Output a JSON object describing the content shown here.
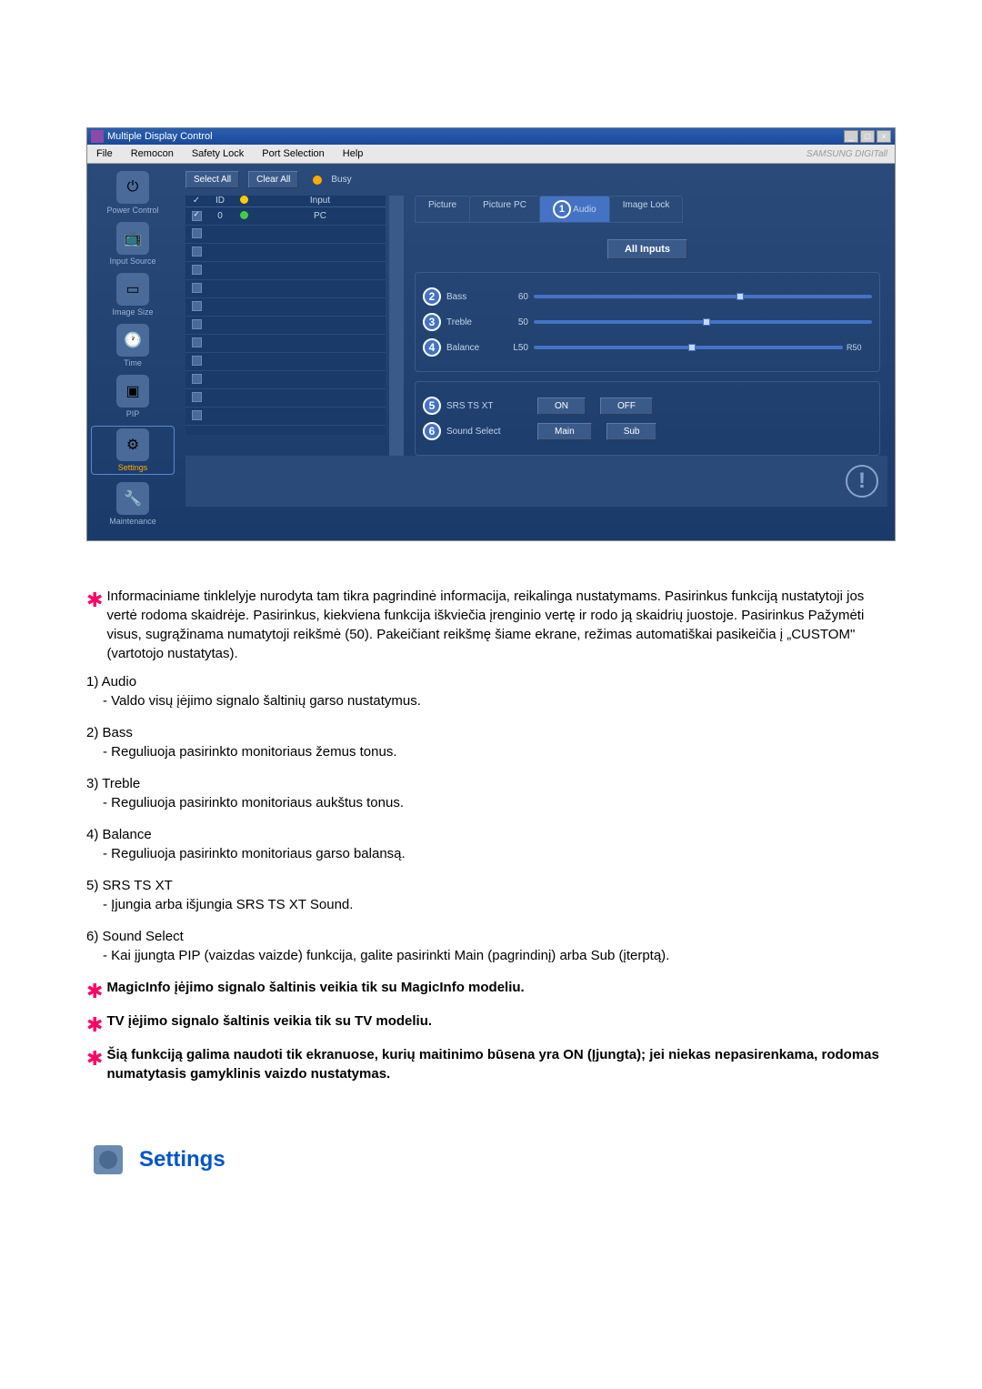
{
  "window": {
    "title": "Multiple Display Control"
  },
  "menu": {
    "file": "File",
    "remocon": "Remocon",
    "safety_lock": "Safety Lock",
    "port_selection": "Port Selection",
    "help": "Help",
    "brand": "SAMSUNG DIGITall"
  },
  "sidebar": {
    "items": [
      {
        "label": "Power Control"
      },
      {
        "label": "Input Source"
      },
      {
        "label": "Image Size"
      },
      {
        "label": "Time"
      },
      {
        "label": "PIP"
      },
      {
        "label": "Settings"
      },
      {
        "label": "Maintenance"
      }
    ]
  },
  "controls": {
    "select_all": "Select All",
    "clear_all": "Clear All",
    "busy": "Busy"
  },
  "list": {
    "headers": {
      "chk": "✓",
      "id": "ID",
      "status": "",
      "input": "Input"
    },
    "rows": [
      {
        "checked": true,
        "id": "0",
        "status": "green",
        "input": "PC"
      },
      {
        "checked": false,
        "id": "",
        "status": "",
        "input": ""
      },
      {
        "checked": false,
        "id": "",
        "status": "",
        "input": ""
      },
      {
        "checked": false,
        "id": "",
        "status": "",
        "input": ""
      },
      {
        "checked": false,
        "id": "",
        "status": "",
        "input": ""
      },
      {
        "checked": false,
        "id": "",
        "status": "",
        "input": ""
      },
      {
        "checked": false,
        "id": "",
        "status": "",
        "input": ""
      },
      {
        "checked": false,
        "id": "",
        "status": "",
        "input": ""
      },
      {
        "checked": false,
        "id": "",
        "status": "",
        "input": ""
      },
      {
        "checked": false,
        "id": "",
        "status": "",
        "input": ""
      },
      {
        "checked": false,
        "id": "",
        "status": "",
        "input": ""
      },
      {
        "checked": false,
        "id": "",
        "status": "",
        "input": ""
      }
    ]
  },
  "tabs": {
    "picture": "Picture",
    "picture_pc": "Picture PC",
    "audio": "Audio",
    "image_lock": "Image Lock",
    "audio_badge": "1"
  },
  "audio_panel": {
    "all_inputs": "All Inputs",
    "bass_badge": "2",
    "bass_label": "Bass",
    "bass_value": "60",
    "treble_badge": "3",
    "treble_label": "Treble",
    "treble_value": "50",
    "balance_badge": "4",
    "balance_label": "Balance",
    "balance_left": "L50",
    "balance_right": "R50",
    "srs_badge": "5",
    "srs_label": "SRS TS XT",
    "srs_on": "ON",
    "srs_off": "OFF",
    "sound_badge": "6",
    "sound_label": "Sound Select",
    "sound_main": "Main",
    "sound_sub": "Sub"
  },
  "doc": {
    "intro": "Informaciniame tinklelyje nurodyta tam tikra pagrindinė informacija, reikalinga nustatymams. Pasirinkus funkciją nustatytoji jos vertė rodoma skaidrėje. Pasirinkus, kiekviena funkcija iškviečia įrenginio vertę ir rodo ją skaidrių juostoje. Pasirinkus Pažymėti visus, sugrąžinama numatytoji reikšmė (50). Pakeičiant reikšmę šiame ekrane, režimas automatiškai pasikeičia į „CUSTOM\" (vartotojo nustatytas).",
    "items": [
      {
        "num": "1)",
        "title": "Audio",
        "desc": "- Valdo visų įėjimo signalo šaltinių garso nustatymus."
      },
      {
        "num": "2)",
        "title": "Bass",
        "desc": "- Reguliuoja pasirinkto monitoriaus žemus tonus."
      },
      {
        "num": "3)",
        "title": "Treble",
        "desc": "- Reguliuoja pasirinkto monitoriaus aukštus tonus."
      },
      {
        "num": "4)",
        "title": "Balance",
        "desc": "- Reguliuoja pasirinkto monitoriaus garso balansą."
      },
      {
        "num": "5)",
        "title": "SRS TS XT",
        "desc": "- Įjungia arba išjungia SRS TS XT Sound."
      },
      {
        "num": "6)",
        "title": "Sound Select",
        "desc": "- Kai įjungta PIP (vaizdas vaizde) funkcija, galite pasirinkti Main (pagrindinį) arba Sub (įterptą)."
      }
    ],
    "note1": "MagicInfo įėjimo signalo šaltinis veikia tik su MagicInfo modeliu.",
    "note2": "TV įėjimo signalo šaltinis veikia tik su TV modeliu.",
    "note3": "Šią funkciją galima naudoti tik ekranuose, kurių maitinimo būsena yra ON (Įjungta); jei niekas nepasirenkama, rodomas numatytasis gamyklinis vaizdo nustatymas.",
    "settings_heading": "Settings"
  }
}
